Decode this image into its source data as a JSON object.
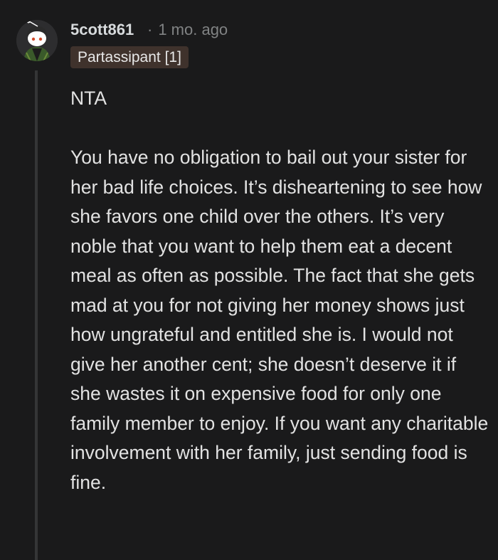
{
  "comment": {
    "username": "5cott861",
    "separator": "·",
    "time_ago": "1 mo. ago",
    "flair": "Partassipant [1]",
    "paragraphs": [
      "NTA",
      "You have no obligation to bail out your sister for her bad life choices. It’s disheartening to see how she favors one child over the others. It’s very noble that you want to help them eat a decent meal as often as possible. The fact that she gets mad at you for not giving her money shows just how ungrateful and entitled she is. I would not give her another cent; she doesn’t deserve it if she wastes it on expensive food for only one family member to enjoy. If you want any charitable involvement with her family, just sending food is fine."
    ]
  },
  "colors": {
    "background": "#1a1a1b",
    "text": "#e2e2e2",
    "meta": "#818384",
    "flair_bg": "#3f322c",
    "thread_line": "#343536"
  },
  "icons": {
    "avatar": "snoo-avatar-icon"
  }
}
